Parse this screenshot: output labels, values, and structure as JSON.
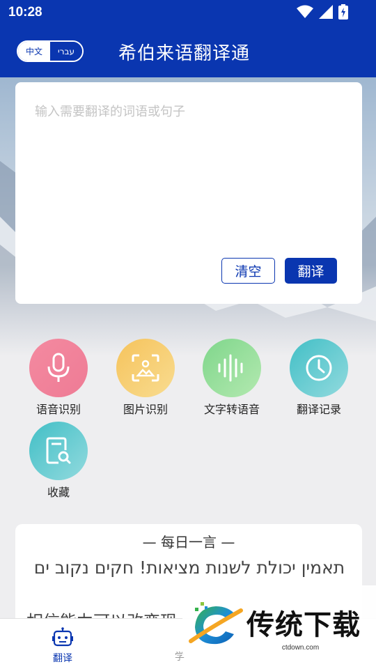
{
  "status_bar": {
    "time": "10:28"
  },
  "header": {
    "lang_chinese": "中文",
    "lang_hebrew": "עברי",
    "title": "希伯来语翻译通"
  },
  "input": {
    "placeholder": "输入需要翻译的词语或句子",
    "value": "",
    "clear_label": "清空",
    "translate_label": "翻译"
  },
  "features": [
    {
      "label": "语音识别",
      "icon": "microphone-icon",
      "color_from": "#f48aa0",
      "color_to": "#ee6f8d"
    },
    {
      "label": "图片识别",
      "icon": "image-scan-icon",
      "color_from": "#f6c96a",
      "color_to": "#f7d98a"
    },
    {
      "label": "文字转语音",
      "icon": "sound-wave-icon",
      "color_from": "#85d98f",
      "color_to": "#a7e6a6"
    },
    {
      "label": "翻译记录",
      "icon": "clock-icon",
      "color_from": "#4ec3c8",
      "color_to": "#8dd7de"
    },
    {
      "label": "收藏",
      "icon": "document-search-icon",
      "color_from": "#4ec3c8",
      "color_to": "#8dd7de"
    }
  ],
  "daily": {
    "title": "—  每日一言  —",
    "hebrew": "תאמין יכולת לשנות מציאות! חקים נקוב ים",
    "chinese": "相信能力可以改变现"
  },
  "bottom_nav": {
    "translate_label": "翻译",
    "second_label": "学"
  },
  "watermark": {
    "text": "传统下载",
    "url": "ctdown.com"
  },
  "colors": {
    "primary": "#0a36b0"
  }
}
